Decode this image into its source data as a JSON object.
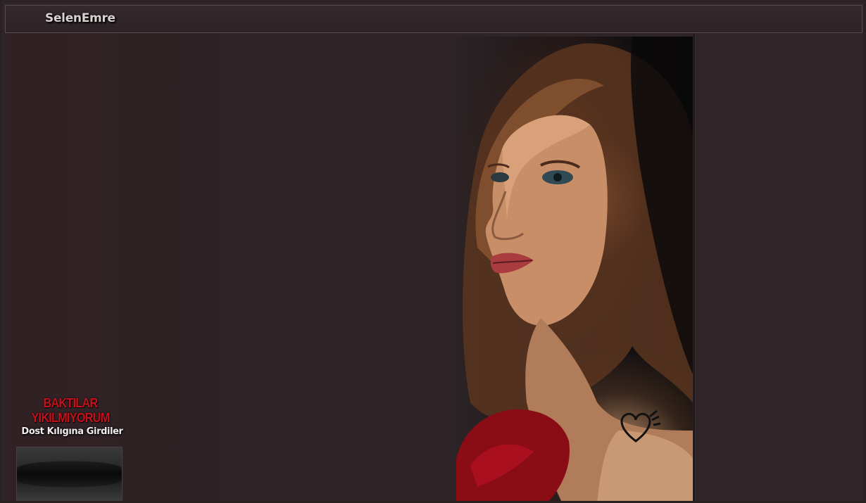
{
  "window": {
    "title": "SelenEmre"
  },
  "caption": {
    "title": "BAKTILAR YIKILMIYORUM",
    "subtitle": "Dost Kılıgına Girdiler"
  },
  "colors": {
    "background": "#2e2326",
    "caption_title": "#c4111c",
    "title_text": "#d9d0d0"
  },
  "portrait": {
    "icon": "woman-portrait-image",
    "watermark": "heart-signature-icon"
  }
}
